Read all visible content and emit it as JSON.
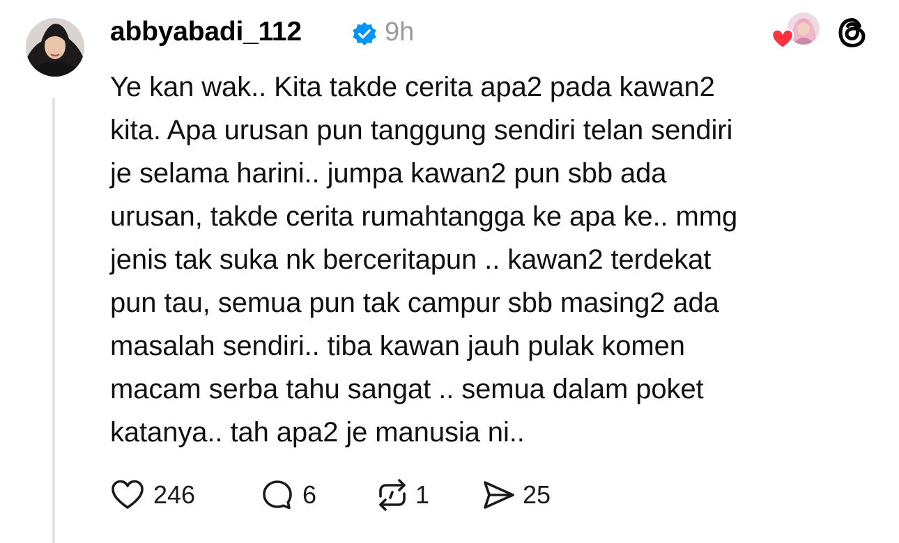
{
  "post": {
    "username": "abbyabadi_112",
    "timestamp": "9h",
    "verified": true,
    "text_lines": [
      "Ye kan wak.. Kita takde cerita apa2 pada kawan2",
      "kita. Apa urusan pun tanggung sendiri telan sendiri",
      "je selama harini.. jumpa kawan2 pun sbb ada",
      "urusan, takde cerita rumahtangga ke apa ke.. mmg",
      "jenis tak suka nk berceritapun .. kawan2 terdekat",
      "pun tau, semua pun tak campur sbb masing2 ada",
      "masalah sendiri.. tiba kawan jauh pulak komen",
      "macam serba tahu sangat .. semua dalam poket",
      "katanya.. tah apa2 je manusia ni.."
    ]
  },
  "actions": {
    "likes": "246",
    "replies": "6",
    "reposts": "1",
    "shares": "25"
  },
  "icons": {
    "verified": "verified-badge-icon",
    "threads": "threads-logo-icon",
    "like": "heart-outline-icon",
    "reply": "speech-bubble-icon",
    "repost": "repost-arrows-icon",
    "share": "send-paper-plane-icon"
  },
  "colors": {
    "verified_blue": "#0095f6",
    "heart_red": "#ff3040",
    "muted_text": "#9a9a9a",
    "thread_line": "#e3e3e3"
  }
}
